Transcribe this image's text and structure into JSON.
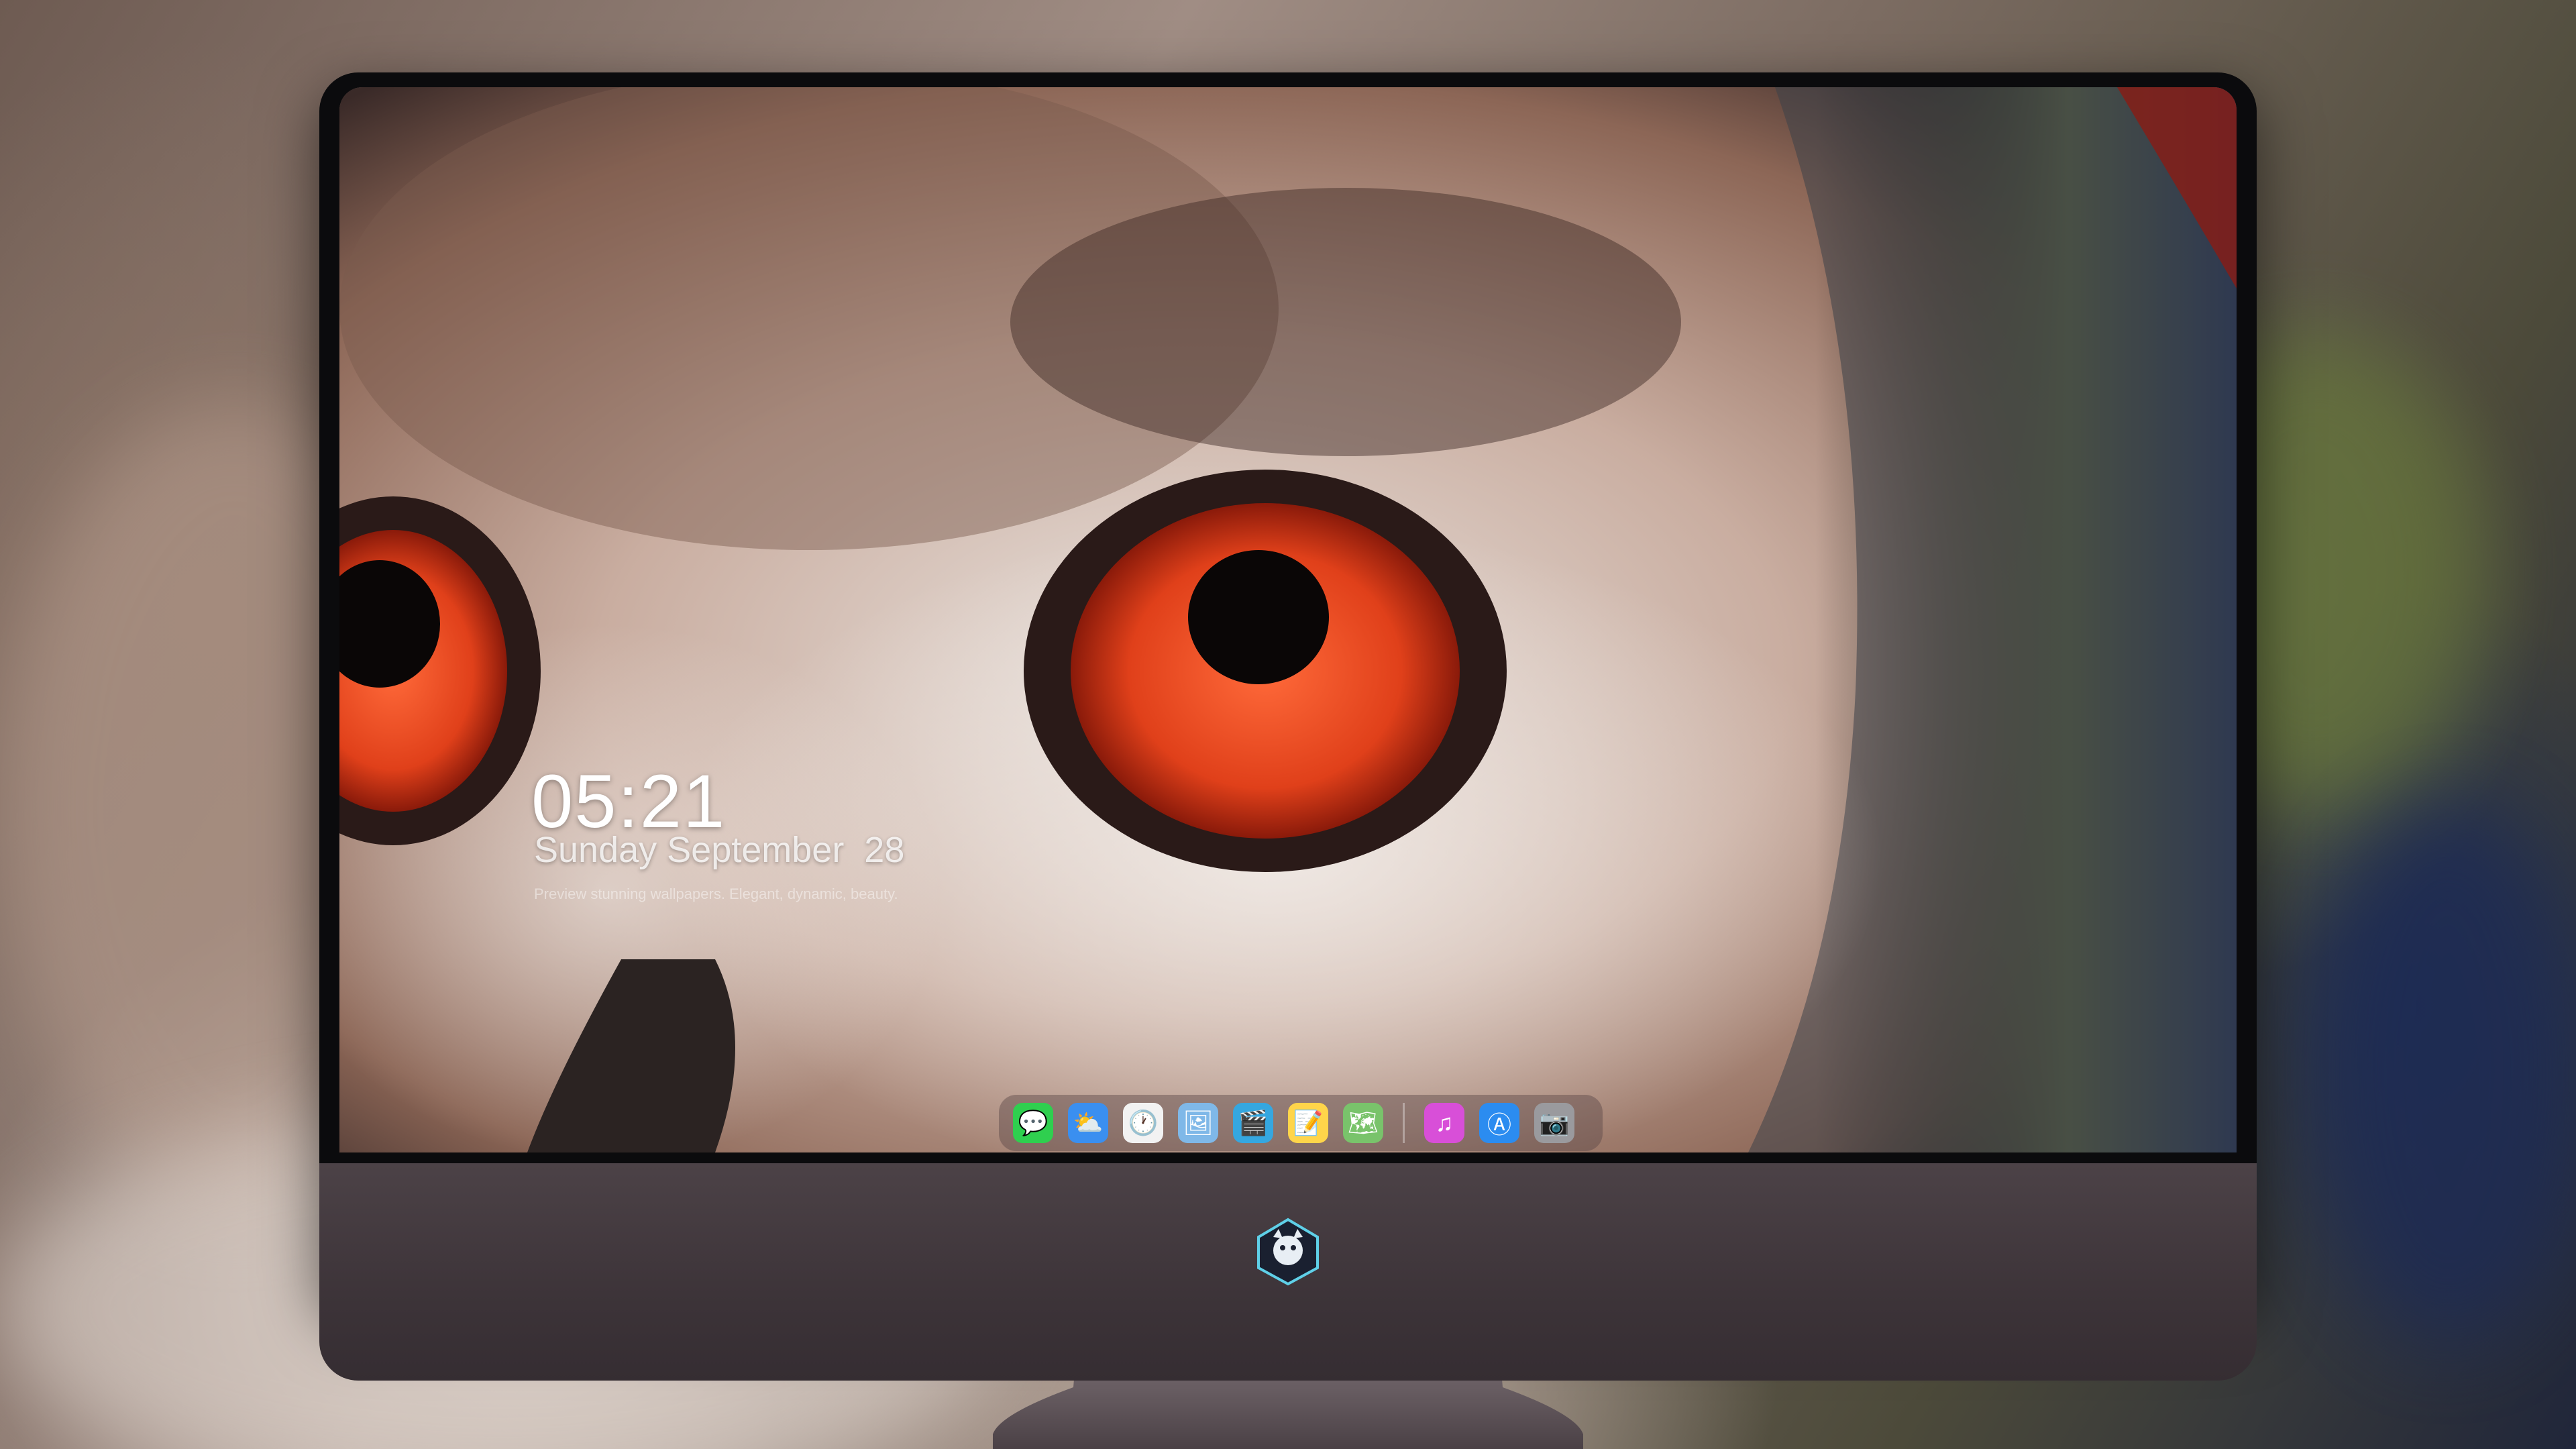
{
  "lockscreen": {
    "time": "05:21",
    "date": "Sunday September  28",
    "caption": "Preview stunning wallpapers. Elegant, dynamic, beauty."
  },
  "dock": {
    "apps": [
      {
        "name": "messages-icon",
        "glyph": "💬",
        "color": "#2fcf4f"
      },
      {
        "name": "weather-icon",
        "glyph": "⛅",
        "color": "#3a8ff0"
      },
      {
        "name": "clock-icon",
        "glyph": "🕐",
        "color": "#f2f2f2"
      },
      {
        "name": "preview-icon",
        "glyph": "🖼",
        "color": "#7fb8e8"
      },
      {
        "name": "video-editor-icon",
        "glyph": "🎬",
        "color": "#35a7e0"
      },
      {
        "name": "notes-icon",
        "glyph": "📝",
        "color": "#ffd54a"
      },
      {
        "name": "maps-icon",
        "glyph": "🗺",
        "color": "#79c36b"
      },
      {
        "name": "music-icon",
        "glyph": "♫",
        "color": "#d84fd8"
      },
      {
        "name": "app-store-icon",
        "glyph": "Ⓐ",
        "color": "#2b8cf0"
      },
      {
        "name": "camera-icon",
        "glyph": "📷",
        "color": "#9a9a9e"
      }
    ],
    "separator_after_index": 6
  },
  "theme": {
    "eye_color": "#e0401a",
    "monitor_chin_color": "#43393e"
  }
}
